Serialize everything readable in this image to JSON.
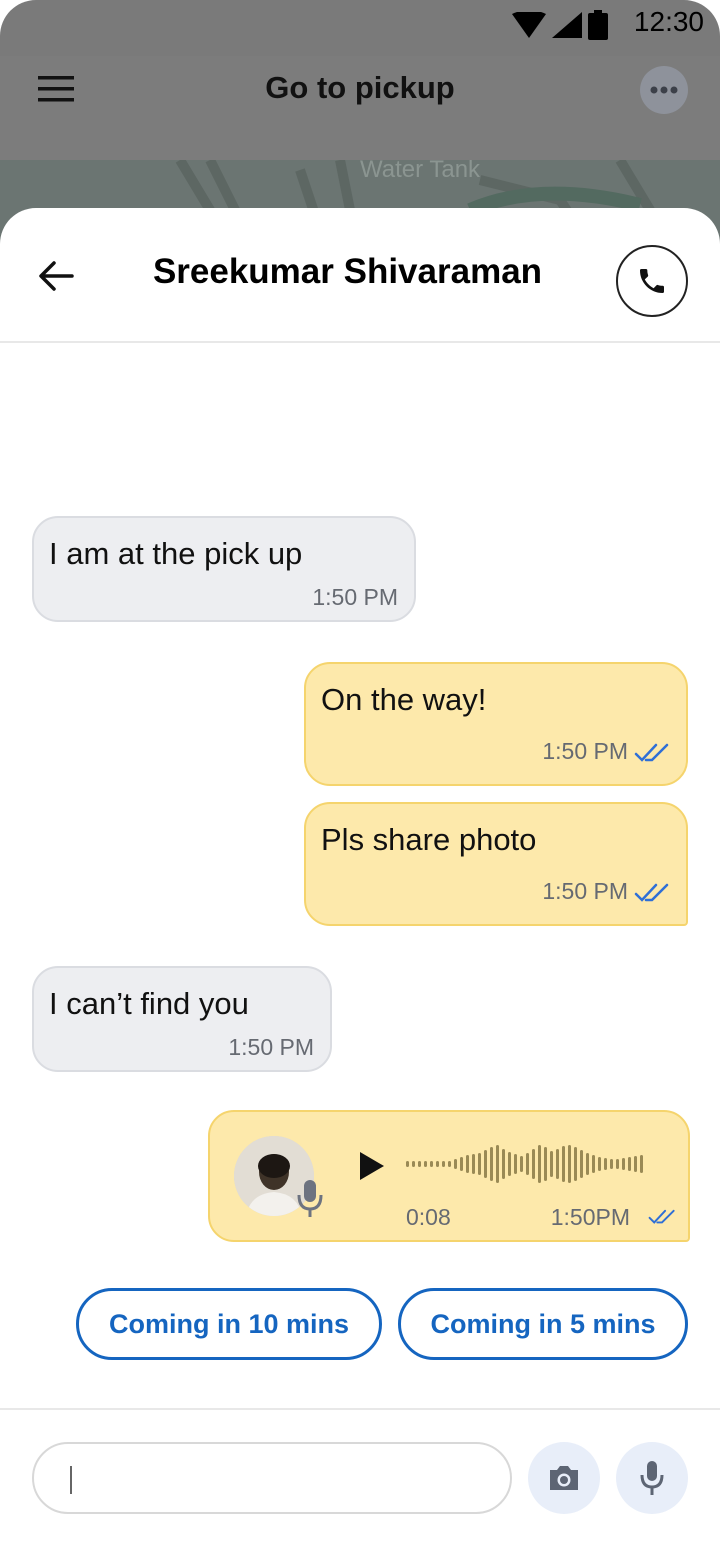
{
  "status_bar": {
    "time": "12:30"
  },
  "background_app": {
    "title": "Go to pickup",
    "map_label": "Water Tank"
  },
  "chat": {
    "contact_name": "Sreekumar Shivaraman",
    "messages": [
      {
        "direction": "incoming",
        "text": "I am at the pick up",
        "time": "1:50 PM"
      },
      {
        "direction": "outgoing",
        "text": "On the way!",
        "time": "1:50 PM",
        "status": "read"
      },
      {
        "direction": "outgoing",
        "text": "Pls share photo",
        "time": "1:50 PM",
        "status": "read"
      },
      {
        "direction": "incoming",
        "text": "I can’t find you",
        "time": "1:50 PM"
      },
      {
        "direction": "outgoing",
        "type": "voice",
        "duration": "0:08",
        "time": "1:50PM",
        "status": "read"
      }
    ],
    "quick_replies": [
      "Coming in 10 mins",
      "Coming in 5 mins"
    ]
  },
  "composer": {
    "input_value": "",
    "placeholder": ""
  },
  "colors": {
    "accent": "#1565c0",
    "outgoing_bubble": "#fde9ab",
    "incoming_bubble": "#edeef1",
    "read_tick": "#2f6fd6"
  },
  "icons": [
    "menu-icon",
    "more-icon",
    "back-arrow-icon",
    "phone-icon",
    "double-check-icon",
    "play-icon",
    "mic-icon",
    "camera-icon"
  ]
}
